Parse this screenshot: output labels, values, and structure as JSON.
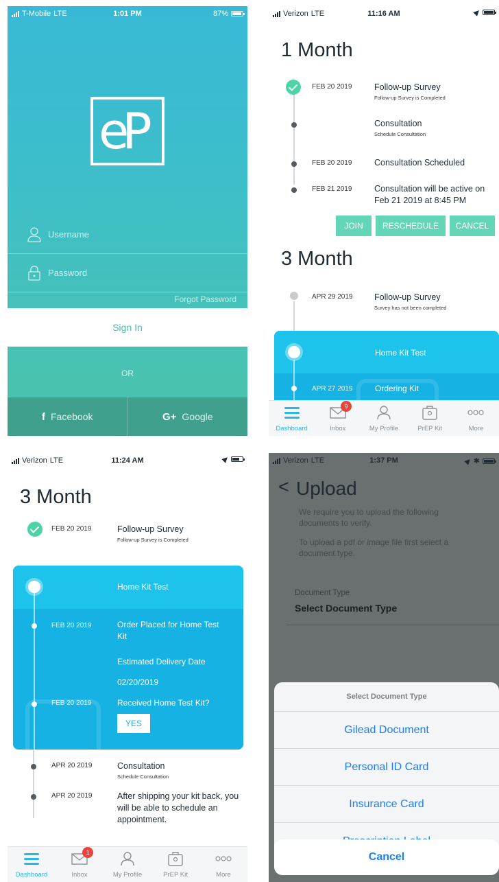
{
  "login": {
    "status": {
      "carrier": "T-Mobile",
      "network": "LTE",
      "time": "1:01 PM",
      "battery": "87%"
    },
    "logo_text": "eP",
    "username_label": "Username",
    "password_label": "Password",
    "forgot_password": "Forgot Password",
    "sign_in": "Sign In",
    "or": "OR",
    "facebook": "Facebook",
    "facebook_glyph": "f",
    "google": "Google",
    "google_glyph": "G+"
  },
  "one_month": {
    "status": {
      "carrier": "Verizon",
      "network": "LTE",
      "time": "11:16 AM"
    },
    "title_1": "1 Month",
    "items": [
      {
        "date": "FEB 20 2019",
        "title": "Follow-up Survey",
        "sub": "Follow-up Survey is Completed"
      },
      {
        "date": "",
        "title": "Consultation",
        "sub": "Schedule Consultation"
      },
      {
        "date": "FEB 20 2019",
        "title": "Consultation Scheduled"
      },
      {
        "date": "FEB 21 2019",
        "title": "Consultation will be active on Feb 21 2019 at 8:45 PM"
      }
    ],
    "buttons": {
      "join": "JOIN",
      "reschedule": "RESCHEDULE",
      "cancel": "CANCEL"
    },
    "title_3": "3 Month",
    "survey": {
      "date": "APR 29 2019",
      "title": "Follow-up Survey",
      "sub": "Survey has not been completed"
    },
    "kit_head": "Home Kit Test",
    "kit_row": {
      "date": "APR 27 2019",
      "title": "Ordering Kit"
    }
  },
  "three_month": {
    "status": {
      "carrier": "Verizon",
      "network": "LTE",
      "time": "11:24 AM"
    },
    "title": "3 Month",
    "survey": {
      "date": "FEB 20 2019",
      "title": "Follow-up Survey",
      "sub": "Follow-up Survey is Completed"
    },
    "kit": {
      "head": "Home Kit Test",
      "order_date": "FEB 20 2019",
      "order_title": "Order Placed for Home Test Kit",
      "delivery_label": "Estimated Delivery Date",
      "delivery_date": "02/20/2019",
      "received_date": "FEB 20 2019",
      "received_title": "Received Home Test Kit?",
      "yes": "YES"
    },
    "items": [
      {
        "date": "APR 20 2019",
        "title": "Consultation",
        "sub": "Schedule Consultation"
      },
      {
        "date": "APR 20 2019",
        "title": "After shipping your kit back, you will be able to schedule an appointment."
      }
    ]
  },
  "tabbar": {
    "tabs": [
      {
        "label": "Dashboard",
        "icon": "dashboard-icon"
      },
      {
        "label": "Inbox",
        "icon": "mail-icon"
      },
      {
        "label": "My Profile",
        "icon": "user-icon"
      },
      {
        "label": "PrEP Kit",
        "icon": "kit-icon"
      },
      {
        "label": "More",
        "icon": "more-icon"
      }
    ],
    "badge_top": "9",
    "badge_bottom": "1",
    "active_color": "#2ab7e4"
  },
  "upload": {
    "status": {
      "carrier": "Verizon",
      "network": "LTE",
      "time": "1:37 PM"
    },
    "back": "<",
    "title": "Upload",
    "p1": "We require you to upload the following documents to verify.",
    "p2": "To upload a pdf or image file first select a document type.",
    "doc_type_label": "Document Type",
    "doc_type_value": "Select Document Type",
    "sheet_title": "Select Document Type",
    "options": [
      "Gilead Document",
      "Personal ID Card",
      "Insurance Card",
      "Prescription Label"
    ],
    "cancel": "Cancel"
  }
}
